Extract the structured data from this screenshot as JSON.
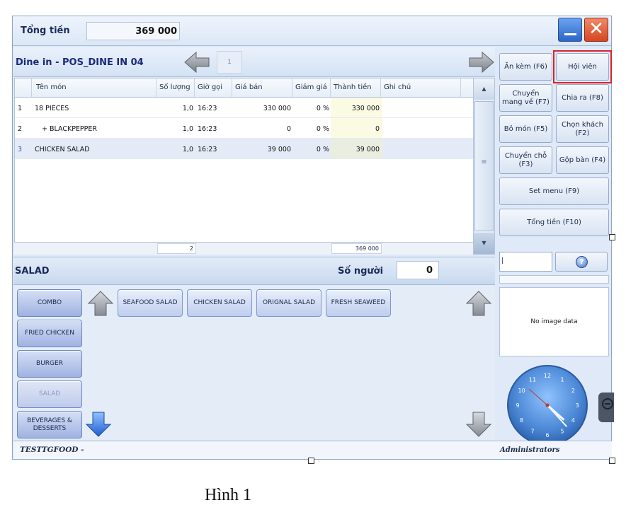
{
  "header": {
    "total_label": "Tổng tiền",
    "total_value": "369 000"
  },
  "order": {
    "title": "Dine in - POS_DINE IN 04",
    "page": "1"
  },
  "grid": {
    "columns": [
      "Tên món",
      "Số lượng",
      "Giờ gọi",
      "Giá bán",
      "Giảm giá",
      "Thành tiền",
      "Ghi chú"
    ],
    "rows": [
      {
        "no": "1",
        "name": "18 PIECES",
        "qty": "1,0",
        "time": "16:23",
        "price": "330 000",
        "discount": "0 %",
        "amount": "330 000",
        "note": ""
      },
      {
        "no": "2",
        "name": "+ BLACKPEPPER",
        "qty": "1,0",
        "time": "16:23",
        "price": "0",
        "discount": "0 %",
        "amount": "0",
        "note": ""
      },
      {
        "no": "3",
        "name": "CHICKEN SALAD",
        "qty": "1,0",
        "time": "16:23",
        "price": "39 000",
        "discount": "0 %",
        "amount": "39 000",
        "note": ""
      }
    ],
    "footer_qty": "2",
    "footer_amount": "369 000"
  },
  "category": {
    "title": "SALAD",
    "guests_label": "Số người",
    "guests_value": "0"
  },
  "menu": {
    "categories": [
      "COMBO",
      "FRIED CHICKEN",
      "BURGER",
      "SALAD",
      "BEVERAGES & DESSERTS"
    ],
    "items": [
      "SEAFOOD SALAD",
      "CHICKEN SALAD",
      "ORIGNAL SALAD",
      "FRESH SEAWEED"
    ]
  },
  "actions": {
    "side_dish": "Ăn kèm (F6)",
    "member": "Hội viên",
    "takeaway": "Chuyển mang về (F7)",
    "split": "Chia ra (F8)",
    "remove_item": "Bỏ món (F5)",
    "choose_customer": "Chọn khách (F2)",
    "move_table": "Chuyển chỗ (F3)",
    "merge_table": "Gộp bàn (F4)",
    "set_menu": "Set menu (F9)",
    "total": "Tổng tiền (F10)"
  },
  "image_placeholder": "No image data",
  "clock": {
    "hour": 4,
    "minute": 23,
    "numbers": [
      "12",
      "1",
      "2",
      "3",
      "4",
      "5",
      "6",
      "7",
      "8",
      "9",
      "10",
      "11"
    ]
  },
  "status": {
    "left": "TESTTGFOOD -",
    "right": "Administrators"
  },
  "caption": "Hình 1",
  "colors": {
    "accent": "#2c66c9",
    "close": "#d6451f",
    "highlight": "#d8242a",
    "panel": "#dfe9f7"
  }
}
